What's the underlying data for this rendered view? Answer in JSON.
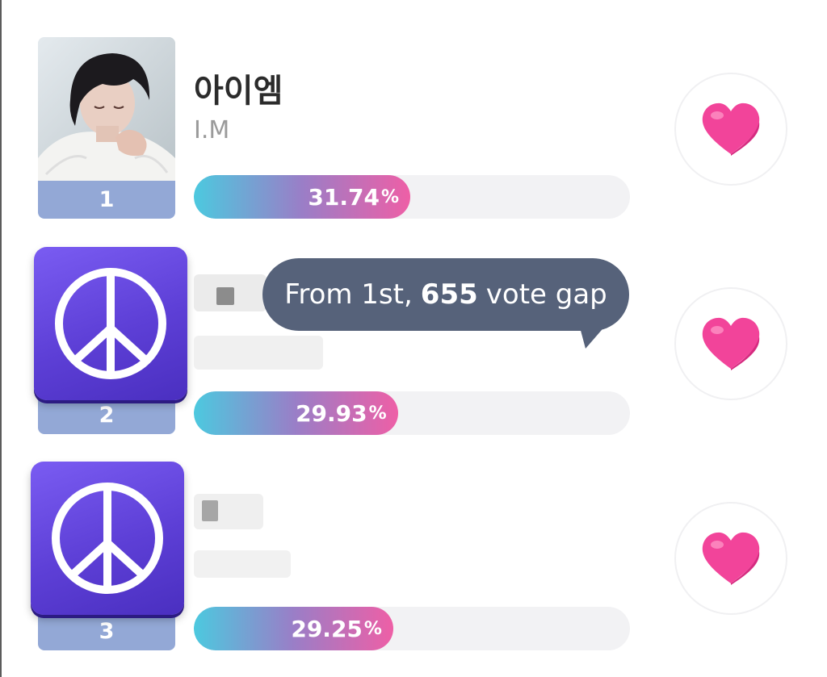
{
  "colors": {
    "rank_plate": "#93a8d6",
    "bar_start": "#4cc9df",
    "bar_end": "#ee5fa6",
    "heart": "#f2449a",
    "tooltip_bg": "#56627a",
    "peace_tile": "#5d3fd6"
  },
  "entries": [
    {
      "rank": "1",
      "name_primary": "아이엠",
      "name_secondary": "I.M",
      "percent_value": "31.74",
      "percent_unit": "%",
      "percent": 31.74,
      "thumbnail_icon": "portrait-photo",
      "vote_icon": "heart-icon"
    },
    {
      "rank": "2",
      "name_primary": "",
      "name_secondary": "",
      "percent_value": "29.93",
      "percent_unit": "%",
      "percent": 29.93,
      "thumbnail_icon": "peace-sign-icon",
      "vote_icon": "heart-icon"
    },
    {
      "rank": "3",
      "name_primary": "",
      "name_secondary": "",
      "percent_value": "29.25",
      "percent_unit": "%",
      "percent": 29.25,
      "thumbnail_icon": "peace-sign-icon",
      "vote_icon": "heart-icon"
    }
  ],
  "tooltip": {
    "prefix": "From 1st,",
    "gap_count": "655",
    "suffix": "vote gap"
  }
}
